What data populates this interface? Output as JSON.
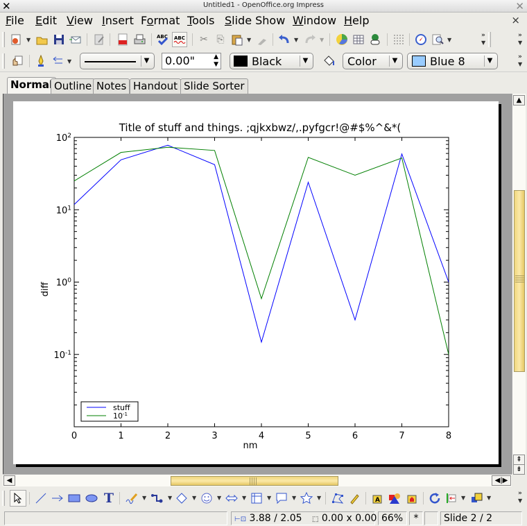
{
  "window": {
    "title": "Untitled1 - OpenOffice.org Impress"
  },
  "menubar": {
    "items": [
      {
        "label": "File",
        "mnemonic": "F",
        "rest": "ile"
      },
      {
        "label": "Edit",
        "mnemonic": "E",
        "rest": "dit"
      },
      {
        "label": "View",
        "mnemonic": "V",
        "rest": "iew"
      },
      {
        "label": "Insert",
        "mnemonic": "I",
        "rest": "nsert"
      },
      {
        "label": "Format",
        "pre": "F",
        "mnemonic": "o",
        "rest": "rmat"
      },
      {
        "label": "Tools",
        "mnemonic": "T",
        "rest": "ools"
      },
      {
        "label": "Slide Show",
        "mnemonic": "S",
        "rest": "lide Show"
      },
      {
        "label": "Window",
        "mnemonic": "W",
        "rest": "indow"
      },
      {
        "label": "Help",
        "mnemonic": "H",
        "rest": "elp"
      }
    ],
    "close_glyph": "×"
  },
  "toolbar_standard": {
    "icons": [
      "new-icon",
      "open-icon",
      "save-icon",
      "email-icon",
      "edit-file-icon",
      "export-pdf-icon",
      "print-icon",
      "spellcheck-icon",
      "autospellcheck-icon",
      "cut-icon",
      "copy-icon",
      "paste-icon",
      "format-paintbrush-icon",
      "undo-icon",
      "redo-icon",
      "chart-icon",
      "table-icon",
      "navigator-icon",
      "grid-icon",
      "navigator-compass-icon",
      "zoom-icon"
    ]
  },
  "toolbar_line_fill": {
    "line_width": "0.00\"",
    "line_color": "Black",
    "line_color_swatch": "#000000",
    "area_style": "Color",
    "area_fill": "Blue 8",
    "area_fill_swatch": "#99ccff"
  },
  "view_tabs": [
    {
      "label": "Normal",
      "active": true
    },
    {
      "label": "Outline",
      "active": false
    },
    {
      "label": "Notes",
      "active": false
    },
    {
      "label": "Handout",
      "active": false
    },
    {
      "label": "Slide Sorter",
      "active": false
    }
  ],
  "status": {
    "position": "3.88 / 2.05",
    "size": "0.00 x 0.00",
    "zoom": "66%",
    "modified": "*",
    "slide": "Slide 2 / 2"
  },
  "chart_data": {
    "type": "line",
    "title": "Title of stuff and things. ;qjkxbwz/,.pyfgcr!@#$%^&*(",
    "xlabel": "nm",
    "ylabel": "diff",
    "xlim": [
      0,
      8
    ],
    "ylim": [
      0.01,
      100
    ],
    "yscale": "log",
    "x": [
      0,
      1,
      2,
      3,
      4,
      5,
      6,
      7,
      8
    ],
    "x_ticks": [
      "0",
      "1",
      "2",
      "3",
      "4",
      "5",
      "6",
      "7",
      "8"
    ],
    "y_ticks": [
      {
        "value": 100,
        "base": "10",
        "exp": "2"
      },
      {
        "value": 10,
        "base": "10",
        "exp": "1"
      },
      {
        "value": 1,
        "base": "10",
        "exp": "0"
      },
      {
        "value": 0.1,
        "base": "10",
        "exp": "-1"
      }
    ],
    "series": [
      {
        "name": "stuff",
        "color": "#0000ff",
        "values": [
          11.8,
          49,
          78,
          42,
          0.148,
          24,
          0.3,
          59,
          1.0
        ]
      },
      {
        "name": "10^-1",
        "legend_base": "10",
        "legend_exp": "-1",
        "color": "#007f00",
        "values": [
          25,
          62,
          73,
          66,
          0.59,
          53,
          30,
          52,
          0.1
        ]
      }
    ],
    "legend": "lower-left",
    "grid": false
  }
}
